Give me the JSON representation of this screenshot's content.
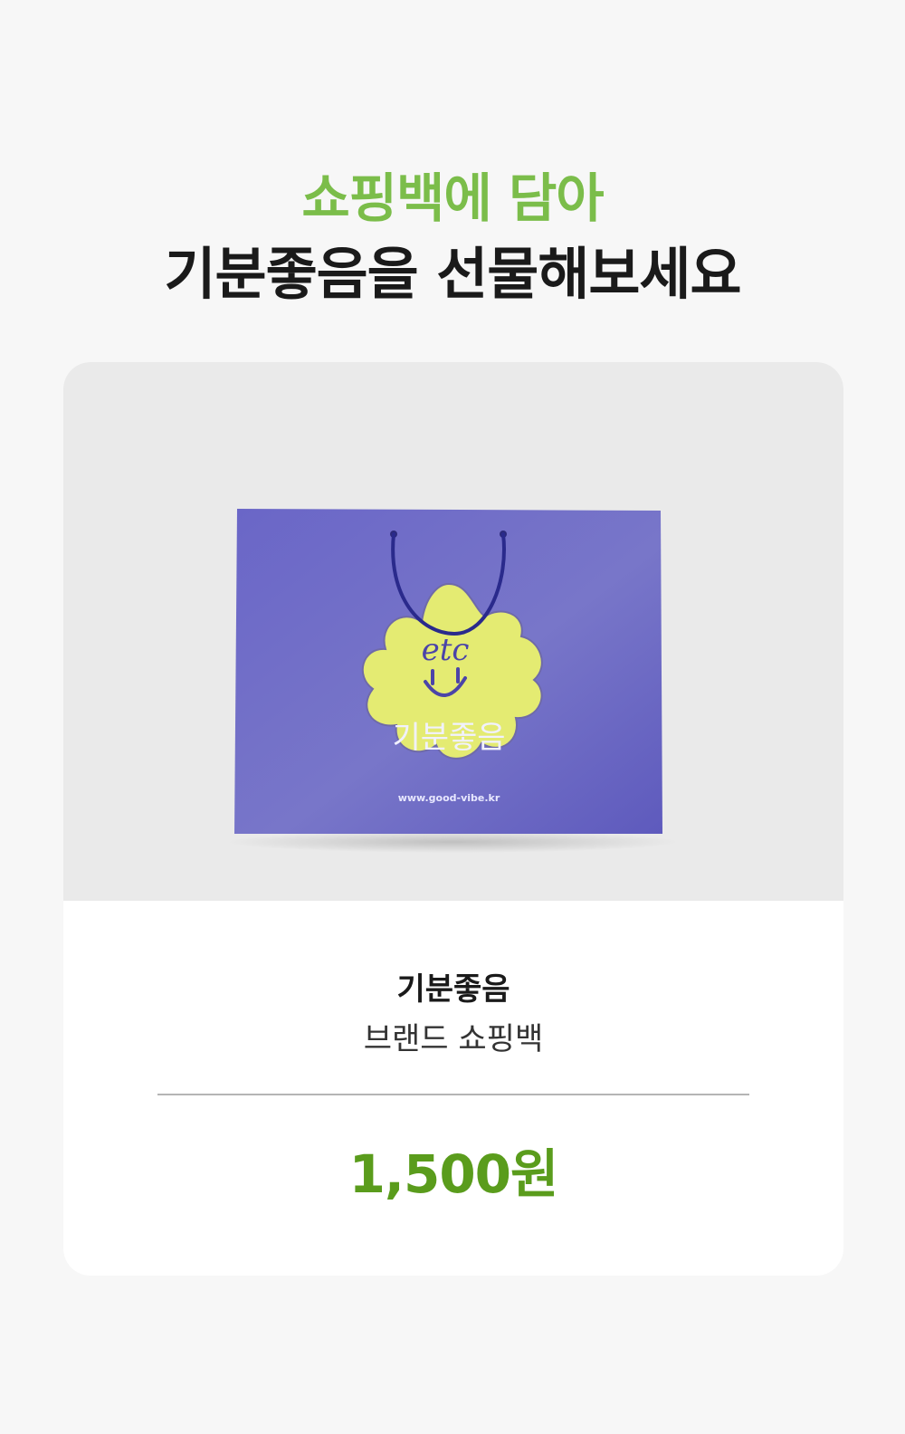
{
  "headline": {
    "line1": "쇼핑백에 담아",
    "line2": "기분좋음을 선물해보세요"
  },
  "product": {
    "bag_logo_text": "etc",
    "bag_brand": "기분좋음",
    "bag_url": "www.good-vibe.kr",
    "name": "기분좋음",
    "subtitle": "브랜드 쇼핑백",
    "price": "1,500원"
  },
  "colors": {
    "headline_accent": "#7bbd4a",
    "bag_body": "#6a66c7",
    "bag_logo": "#e4eb72",
    "price": "#5a9c1c"
  }
}
